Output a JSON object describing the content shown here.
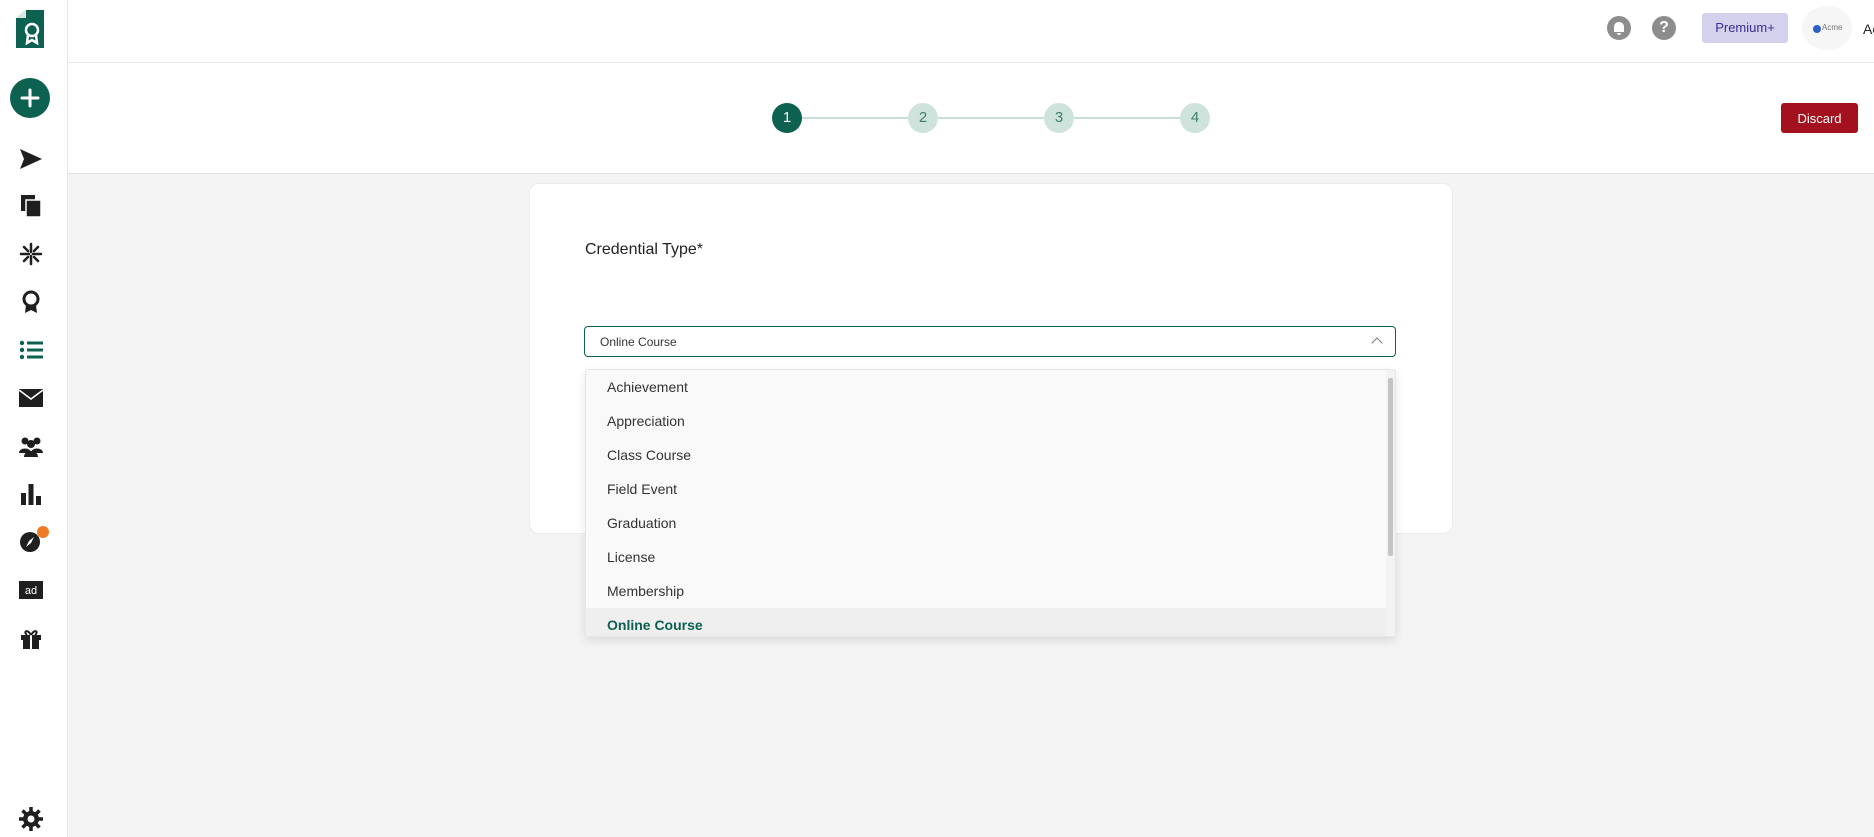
{
  "header": {
    "premium_label": "Premium+",
    "help_symbol": "?",
    "org_name": "Acme",
    "avatar_text": "Acme"
  },
  "stepper": {
    "steps": [
      "1",
      "2",
      "3",
      "4"
    ],
    "active_step": 1,
    "discard_label": "Discard"
  },
  "form": {
    "title": "Credential Type*",
    "selected_value": "Online Course"
  },
  "dropdown": {
    "options": [
      "Achievement",
      "Appreciation",
      "Class Course",
      "Field Event",
      "Graduation",
      "License",
      "Membership",
      "Online Course"
    ],
    "selected_index": 7
  },
  "sidebar": {
    "icons": [
      "logo-icon",
      "add-icon",
      "send-icon",
      "copy-icon",
      "magic-icon",
      "award-icon",
      "list-icon",
      "mail-icon",
      "users-icon",
      "chart-icon",
      "compass-icon",
      "ad-icon",
      "gift-icon",
      "settings-icon"
    ],
    "badge_color": "#f07b25"
  },
  "colors": {
    "brand": "#0d6150",
    "danger": "#a3111f",
    "premium_bg": "#d4d1ec",
    "premium_text": "#3b2e91"
  }
}
